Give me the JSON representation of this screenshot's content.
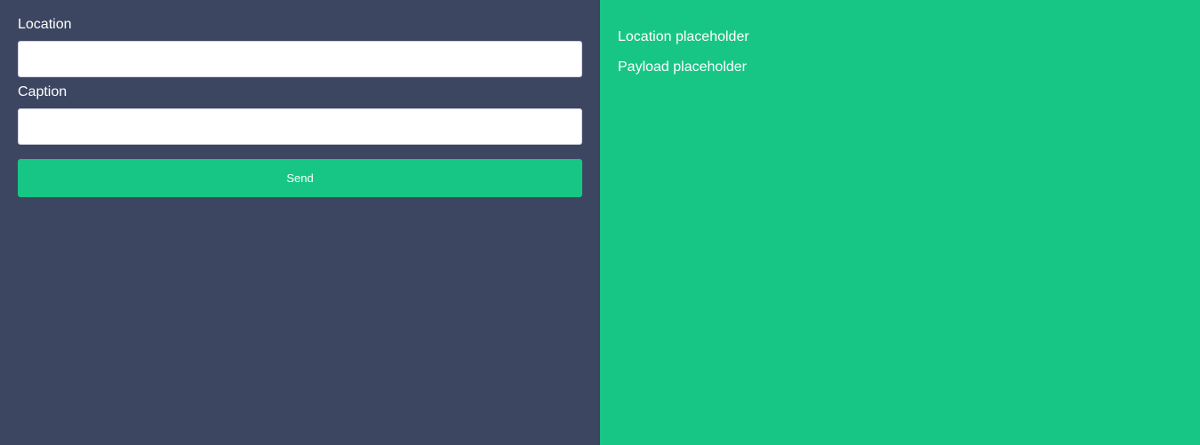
{
  "form": {
    "location_label": "Location",
    "location_value": "",
    "caption_label": "Caption",
    "caption_value": "",
    "send_label": "Send"
  },
  "output": {
    "location_text": "Location placeholder",
    "payload_text": "Payload placeholder"
  },
  "colors": {
    "left_panel_bg": "#3c4661",
    "accent": "#17c685",
    "text": "#ffffff"
  }
}
